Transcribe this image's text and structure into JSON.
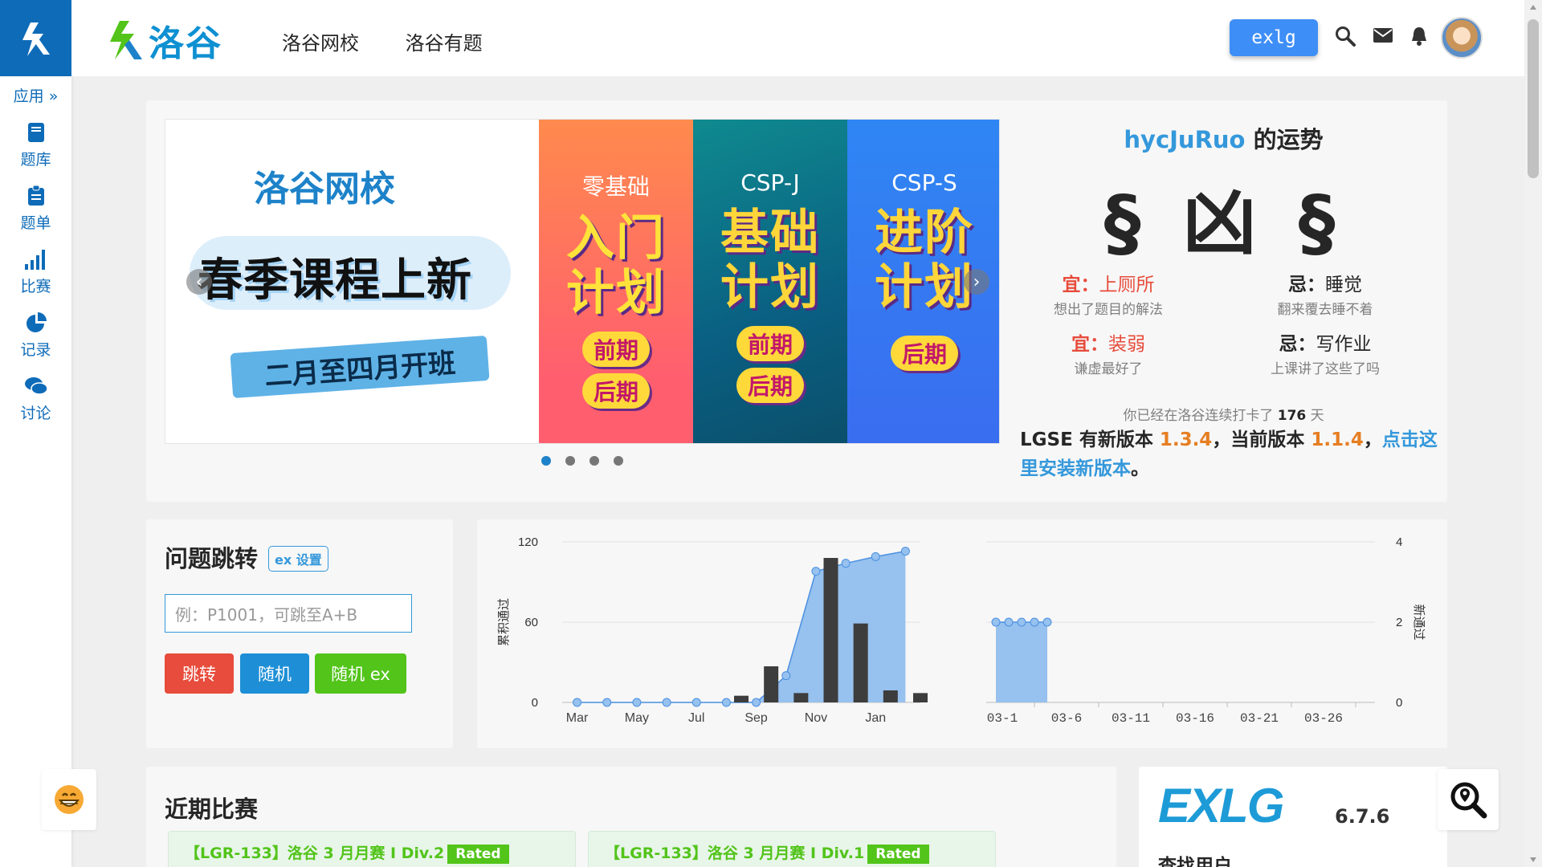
{
  "sidebar": {
    "apps_label": "应用",
    "items": [
      {
        "label": "题库",
        "icon": "book-icon"
      },
      {
        "label": "题单",
        "icon": "clipboard-icon"
      },
      {
        "label": "比赛",
        "icon": "bar-chart-icon"
      },
      {
        "label": "记录",
        "icon": "pie-chart-icon"
      },
      {
        "label": "讨论",
        "icon": "comments-icon"
      }
    ]
  },
  "header": {
    "brand": "洛谷",
    "nav": [
      "洛谷网校",
      "洛谷有题"
    ],
    "exlg_button": "exlg"
  },
  "carousel": {
    "school": "洛谷网校",
    "headline": "春季课程上新",
    "ribbon": "二月至四月开班",
    "panels": [
      {
        "sub": "零基础",
        "big1": "入门",
        "big2": "计划",
        "tags": [
          "前期",
          "后期"
        ]
      },
      {
        "sub": "CSP-J",
        "big1": "基础",
        "big2": "计划",
        "tags": [
          "前期",
          "后期"
        ]
      },
      {
        "sub": "CSP-S",
        "big1": "进阶",
        "big2": "计划",
        "tags": [
          "后期"
        ]
      }
    ]
  },
  "fortune": {
    "username": "hycJuRuo",
    "title_suffix": " 的运势",
    "result": "§ 凶 §",
    "good_label": "宜：",
    "bad_label": "忌：",
    "good1": "上厕所",
    "good1_desc": "想出了题目的解法",
    "bad1": "睡觉",
    "bad1_desc": "翻来覆去睡不着",
    "good2": "装弱",
    "good2_desc": "谦虚最好了",
    "bad2": "写作业",
    "bad2_desc": "上课讲了这些了吗",
    "streak_prefix": "你已经在洛谷连续打卡了 ",
    "streak_days": "176",
    "streak_suffix": " 天",
    "update_prefix": "LGSE 有新版本 ",
    "new_version": "1.3.4",
    "update_mid": "，当前版本 ",
    "current_version": "1.1.4",
    "update_comma": "，",
    "update_link": "点击这里安装新版本",
    "update_end": "。"
  },
  "jump": {
    "title": "问题跳转",
    "ex_tag": "ex 设置",
    "placeholder": "例：P1001，可跳至A+B",
    "btn_jump": "跳转",
    "btn_random": "随机",
    "btn_random_ex": "随机 ex"
  },
  "chart_data": [
    {
      "type": "bar",
      "ylabel": "累积通过",
      "ylim": [
        0,
        120
      ],
      "yticks": [
        "0",
        "60",
        "120"
      ],
      "xticks": [
        "Mar",
        "May",
        "Jul",
        "Sep",
        "Nov",
        "Jan"
      ],
      "bars": [
        0,
        0,
        0,
        0,
        0,
        5,
        27,
        7,
        108,
        59,
        9,
        7
      ],
      "cumulative": [
        0,
        0,
        0,
        0,
        0,
        0,
        0,
        20,
        98,
        104,
        109,
        113
      ],
      "colors": {
        "bar": "#3d3d3d",
        "area": "#97c1ee",
        "line": "#4a90e2"
      }
    },
    {
      "type": "area",
      "ylabel": "新通过",
      "ylim": [
        0,
        4
      ],
      "yticks": [
        "0",
        "2",
        "4"
      ],
      "xticks": [
        "03-1",
        "03-6",
        "03-11",
        "03-16",
        "03-21",
        "03-26"
      ],
      "values": [
        2,
        2,
        2,
        2,
        2
      ],
      "colors": {
        "area": "#97c1ee",
        "line": "#4a90e2"
      }
    }
  ],
  "contests": {
    "title": "近期比赛",
    "items": [
      {
        "name": "【LGR-133】洛谷 3 月月赛 I Div.2",
        "badge": "Rated"
      },
      {
        "name": "【LGR-133】洛谷 3 月月赛 I Div.1",
        "badge": "Rated"
      }
    ]
  },
  "exlg": {
    "logo": "EXLG",
    "version": "6.7.6",
    "find_user": "查找用户"
  }
}
